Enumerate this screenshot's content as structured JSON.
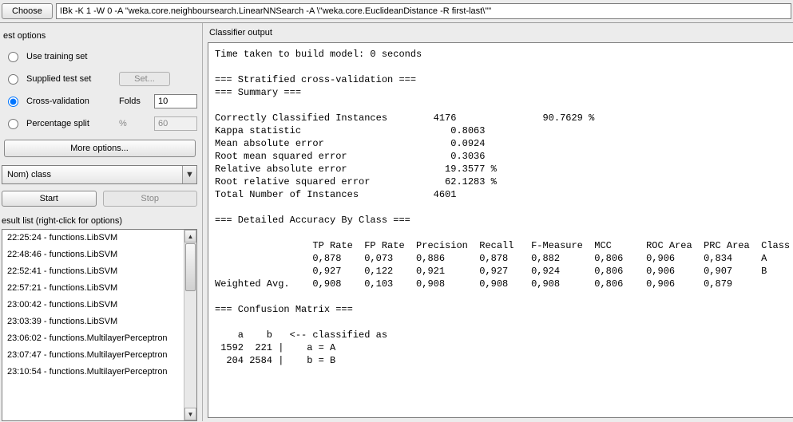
{
  "topbar": {
    "choose_label": "Choose",
    "command": "IBk -K 1 -W 0 -A \"weka.core.neighboursearch.LinearNNSearch -A \\\"weka.core.EuclideanDistance -R first-last\\\"\""
  },
  "test_options": {
    "title": "est options",
    "use_training_set": "Use training set",
    "supplied_test_set": "Supplied test set",
    "set_btn": "Set...",
    "cross_validation": "Cross-validation",
    "folds_label": "Folds",
    "folds_value": "10",
    "percentage_split": "Percentage split",
    "percent_label": "%",
    "percent_value": "60",
    "more_options": "More options..."
  },
  "attribute_combo": "Nom) class",
  "start_label": "Start",
  "stop_label": "Stop",
  "result_list_title": "esult list (right-click for options)",
  "result_items": [
    "22:25:24 - functions.LibSVM",
    "22:48:46 - functions.LibSVM",
    "22:52:41 - functions.LibSVM",
    "22:57:21 - functions.LibSVM",
    "23:00:42 - functions.LibSVM",
    "23:03:39 - functions.LibSVM",
    "23:06:02 - functions.MultilayerPerceptron",
    "23:07:47 - functions.MultilayerPerceptron",
    "23:10:54 - functions.MultilayerPerceptron"
  ],
  "classifier_output_title": "Classifier output",
  "output_text": "Time taken to build model: 0 seconds\n\n=== Stratified cross-validation ===\n=== Summary ===\n\nCorrectly Classified Instances        4176               90.7629 %\nKappa statistic                          0.8063\nMean absolute error                      0.0924\nRoot mean squared error                  0.3036\nRelative absolute error                 19.3577 %\nRoot relative squared error             62.1283 %\nTotal Number of Instances             4601\n\n=== Detailed Accuracy By Class ===\n\n                 TP Rate  FP Rate  Precision  Recall   F-Measure  MCC      ROC Area  PRC Area  Class\n                 0,878    0,073    0,886      0,878    0,882      0,806    0,906     0,834     A\n                 0,927    0,122    0,921      0,927    0,924      0,806    0,906     0,907     B\nWeighted Avg.    0,908    0,103    0,908      0,908    0,908      0,806    0,906     0,879\n\n=== Confusion Matrix ===\n\n    a    b   <-- classified as\n 1592  221 |    a = A\n  204 2584 |    b = B\n"
}
